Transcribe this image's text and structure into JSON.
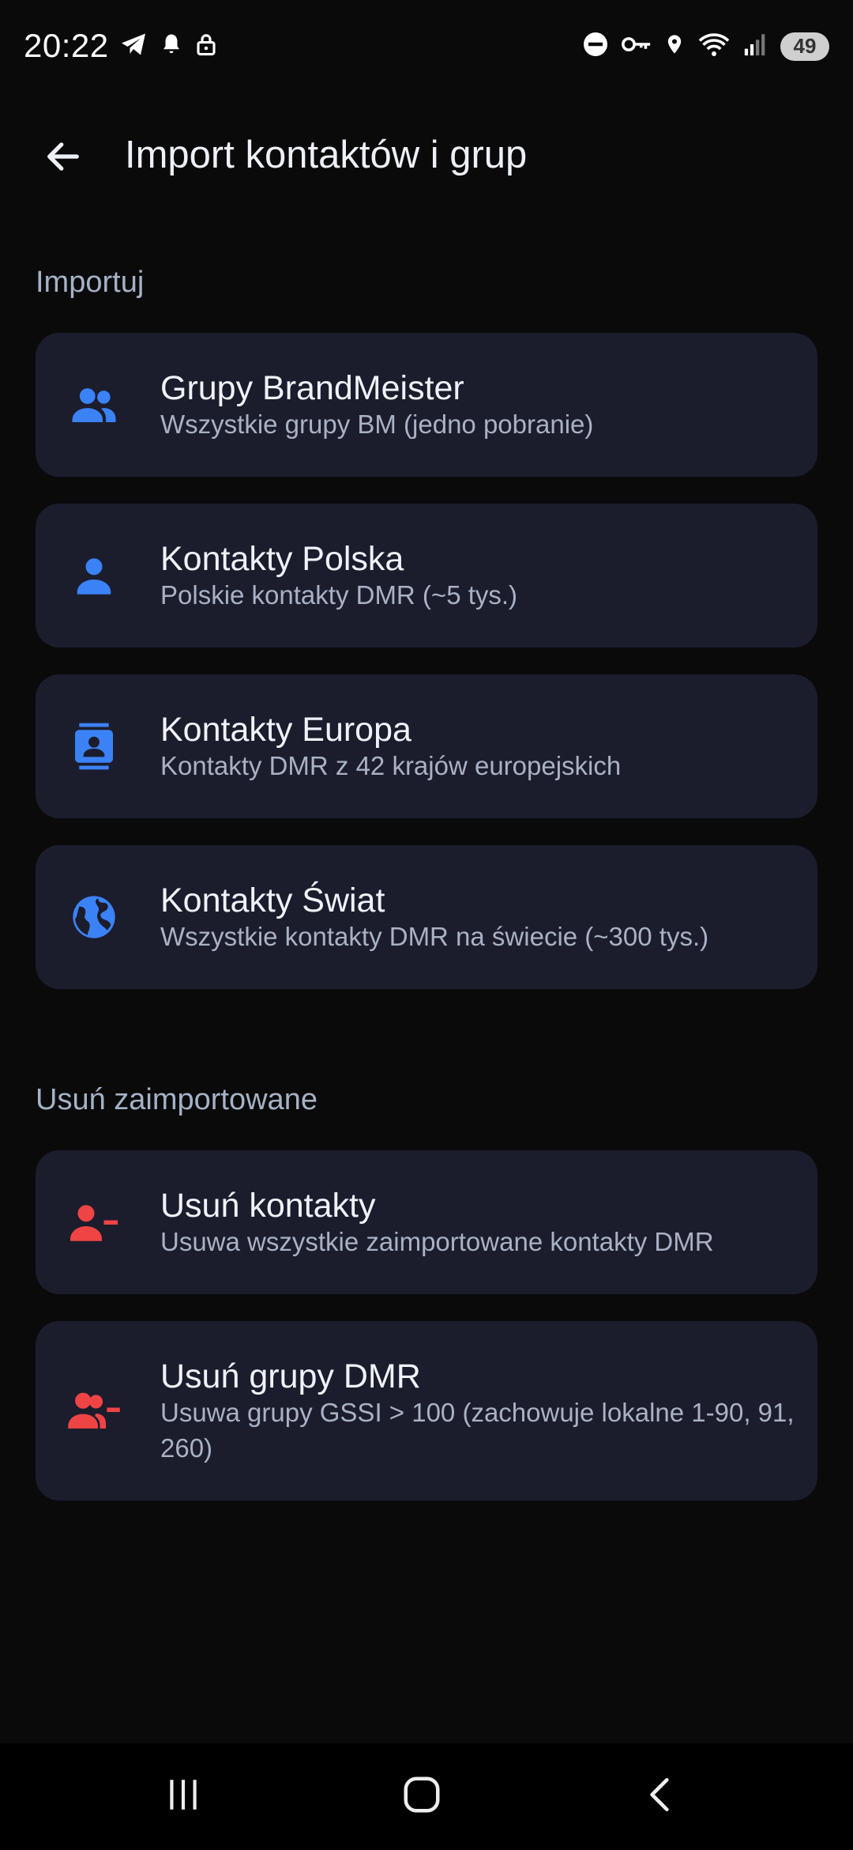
{
  "status_bar": {
    "time": "20:22",
    "battery": "49",
    "icons_left": [
      "telegram-icon",
      "notification-bell-icon",
      "lock-icon"
    ],
    "icons_right": [
      "do-not-disturb-icon",
      "vpn-key-icon",
      "location-icon",
      "wifi-icon",
      "signal-icon",
      "battery-icon"
    ]
  },
  "app_bar": {
    "title": "Import kontaktów i grup"
  },
  "colors": {
    "background": "#0a0a0b",
    "card": "#1b1d2d",
    "accent_blue": "#3b82f6",
    "accent_red": "#ef4444",
    "section_title": "#a5b2c6"
  },
  "sections": {
    "import": {
      "title": "Importuj",
      "items": [
        {
          "title": "Grupy BrandMeister",
          "subtitle": "Wszystkie grupy BM (jedno pobranie)",
          "icon": "group-icon"
        },
        {
          "title": "Kontakty Polska",
          "subtitle": "Polskie kontakty DMR (~5 tys.)",
          "icon": "person-icon"
        },
        {
          "title": "Kontakty Europa",
          "subtitle": "Kontakty DMR z 42 krajów europejskich",
          "icon": "contacts-card-icon"
        },
        {
          "title": "Kontakty Świat",
          "subtitle": "Wszystkie kontakty DMR na świecie (~300 tys.)",
          "icon": "globe-icon"
        }
      ]
    },
    "remove": {
      "title": "Usuń zaimportowane",
      "items": [
        {
          "title": "Usuń kontakty",
          "subtitle": "Usuwa wszystkie zaimportowane kontakty DMR",
          "icon": "person-remove-icon"
        },
        {
          "title": "Usuń grupy DMR",
          "subtitle": "Usuwa grupy GSSI > 100 (zachowuje lokalne 1-90, 91, 260)",
          "icon": "group-remove-icon"
        }
      ]
    }
  },
  "nav_bar": {
    "buttons": [
      "recent-apps-icon",
      "home-icon",
      "back-icon"
    ]
  }
}
